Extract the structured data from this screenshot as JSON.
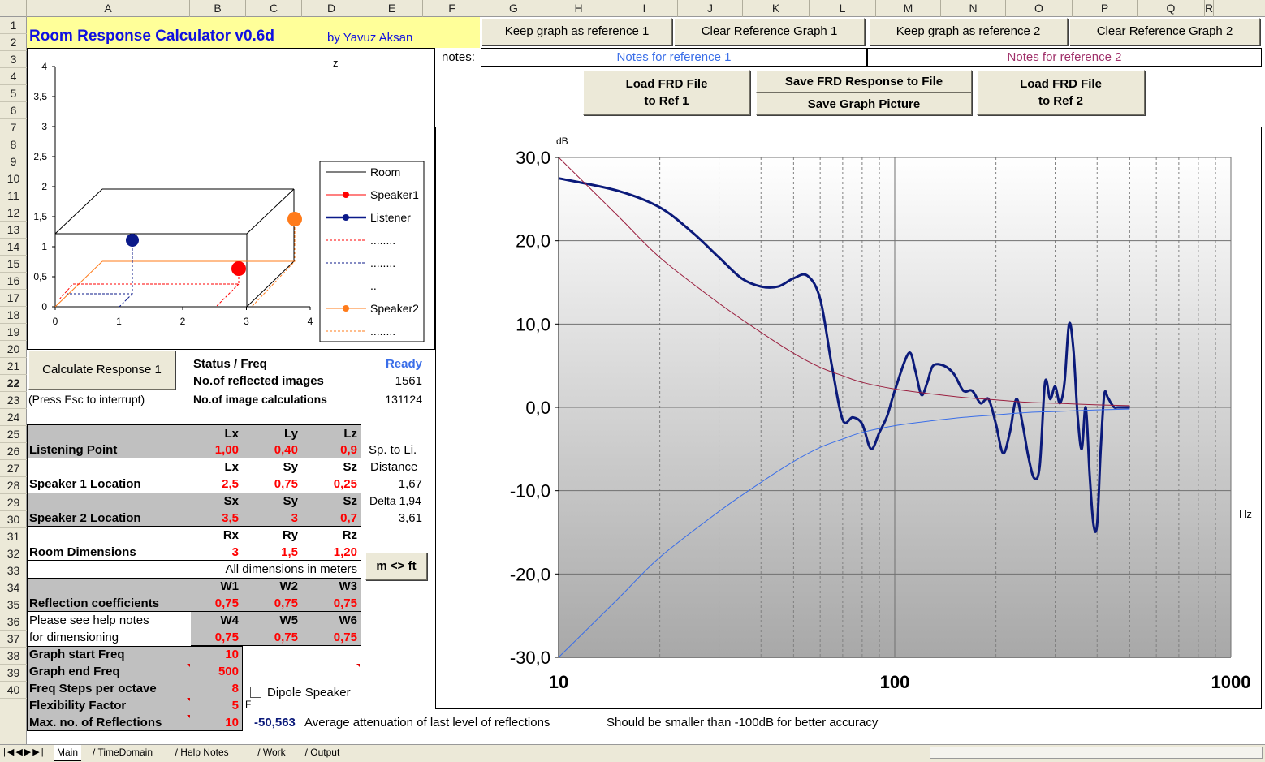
{
  "columns": [
    "A",
    "B",
    "C",
    "D",
    "E",
    "F",
    "G",
    "H",
    "I",
    "J",
    "K",
    "L",
    "M",
    "N",
    "O",
    "P",
    "Q",
    "R"
  ],
  "rows": [
    "1",
    "2",
    "3",
    "4",
    "5",
    "6",
    "7",
    "8",
    "9",
    "10",
    "11",
    "12",
    "13",
    "14",
    "15",
    "16",
    "17",
    "18",
    "19",
    "20",
    "21",
    "22",
    "23",
    "24",
    "25",
    "26",
    "27",
    "28",
    "29",
    "30",
    "31",
    "32",
    "33",
    "34",
    "35",
    "36",
    "37",
    "38",
    "39",
    "40"
  ],
  "title": "Room Response Calculator  v0.6d",
  "author": "by Yavuz Aksan",
  "buttons": {
    "keep_ref1": "Keep graph as reference 1",
    "clear_ref1": "Clear Reference Graph 1",
    "keep_ref2": "Keep graph as reference 2",
    "clear_ref2": "Clear Reference Graph 2",
    "load_frd1_a": "Load FRD File",
    "load_frd1_b": "to Ref 1",
    "save_frd": "Save FRD Response to File",
    "save_pic": "Save Graph Picture",
    "load_frd2_a": "Load FRD File",
    "load_frd2_b": "to Ref 2",
    "calc": "Calculate Response 1",
    "units": "m <> ft"
  },
  "notes_label": "notes:",
  "notes_ref1": "Notes for reference 1",
  "notes_ref2": "Notes for reference 2",
  "room_chart": {
    "z_label": "z",
    "y_ticks": [
      "4",
      "3,5",
      "3",
      "2,5",
      "2",
      "1,5",
      "1",
      "0,5",
      "0"
    ],
    "x_ticks": [
      "0",
      "1",
      "2",
      "3",
      "4"
    ],
    "legend": [
      "Room",
      "Speaker1",
      "Listener",
      "........",
      "........",
      "..",
      "Speaker2",
      "........"
    ],
    "colors": {
      "speaker1": "#ff0000",
      "listener": "#0b1a8a",
      "speaker2": "#ff7b1a"
    }
  },
  "status": {
    "status_label": "Status / Freq",
    "status_value": "Ready",
    "refl_label": "No.of reflected images",
    "refl_value": "1561",
    "calc_label": "No.of image calculations",
    "calc_value": "131124",
    "esc_note": "(Press Esc to interrupt)"
  },
  "params": {
    "lx": "Lx",
    "ly": "Ly",
    "lz": "Lz",
    "listening_label": "Listening Point",
    "listening": [
      "1,00",
      "0,40",
      "0,9"
    ],
    "sp_to_li": "Sp. to Li.",
    "lx2": "Lx",
    "sy": "Sy",
    "sz": "Sz",
    "distance": "Distance",
    "sp1_label": "Speaker 1 Location",
    "sp1": [
      "2,5",
      "0,75",
      "0,25"
    ],
    "sp1_dist": "1,67",
    "sx": "Sx",
    "sy2": "Sy",
    "sz2": "Sz",
    "delta": "Delta 1,94",
    "sp2_label": "Speaker 2 Location",
    "sp2": [
      "3,5",
      "3",
      "0,7"
    ],
    "sp2_dist": "3,61",
    "rx": "Rx",
    "ry": "Ry",
    "rz": "Rz",
    "room_label": "Room Dimensions",
    "room": [
      "3",
      "1,5",
      "1,20"
    ],
    "all_dims": "All dimensions in meters",
    "w1": "W1",
    "w2": "W2",
    "w3": "W3",
    "refl_label": "Reflection coefficients",
    "refl": [
      "0,75",
      "0,75",
      "0,75"
    ],
    "help1": "Please see help notes",
    "help2": "for dimensioning",
    "w4": "W4",
    "w5": "W5",
    "w6": "W6",
    "refl2": [
      "0,75",
      "0,75",
      "0,75"
    ],
    "start_label": "Graph start Freq",
    "start_value": "10",
    "end_label": "Graph end Freq",
    "end_value": "500",
    "steps_label": "Freq Steps per octave",
    "steps_value": "8",
    "flex_label": "Flexibility Factor",
    "flex_value": "5",
    "flex_suffix": "F",
    "maxrefl_label": "Max. no. of Reflections",
    "maxrefl_value": "10",
    "dipole": "Dipole Speaker",
    "atten_value": "-50,563",
    "atten_label": "Average attenuation of last level of reflections",
    "atten_note": "Should be smaller than -100dB for better accuracy"
  },
  "chart_data": {
    "type": "line",
    "ylabel": "dB",
    "xlabel": "Hz",
    "x_scale": "log",
    "xlim": [
      10,
      1000
    ],
    "ylim": [
      -30,
      30
    ],
    "x_ticks": [
      "10",
      "100",
      "1000"
    ],
    "y_ticks": [
      "30,0",
      "20,0",
      "10,0",
      "0,0",
      "-10,0",
      "-20,0",
      "-30,0"
    ],
    "series": [
      {
        "color": "#0b1a7a",
        "x": [
          10,
          15,
          20,
          25,
          30,
          35,
          40,
          45,
          50,
          55,
          60,
          65,
          70,
          75,
          80,
          85,
          90,
          95,
          100,
          110,
          115,
          120,
          125,
          130,
          140,
          150,
          160,
          170,
          180,
          190,
          200,
          210,
          220,
          230,
          240,
          250,
          260,
          270,
          280,
          290,
          300,
          310,
          320,
          330,
          340,
          350,
          360,
          370,
          380,
          390,
          400,
          410,
          420,
          430,
          440,
          450,
          460,
          470,
          480,
          490,
          500
        ],
        "y": [
          27.5,
          26,
          24,
          21,
          18,
          15.5,
          14.5,
          14.5,
          15.5,
          15.8,
          13,
          5,
          -1.5,
          -1.2,
          -2,
          -5,
          -3,
          -1,
          2,
          6.5,
          4.5,
          1.5,
          3,
          5,
          5,
          4,
          2,
          2,
          0.5,
          1,
          -2,
          -5.5,
          -3,
          1,
          -2,
          -6,
          -8.5,
          -7,
          3,
          1,
          2.5,
          0.5,
          3,
          10,
          7,
          -1,
          -5,
          0,
          -8,
          -14,
          -14,
          -5,
          1.5,
          1.2,
          0.5,
          0,
          0,
          0,
          0,
          0,
          0
        ]
      },
      {
        "color": "#9b2040",
        "x": [
          10,
          15,
          20,
          30,
          40,
          50,
          60,
          70,
          80,
          100,
          130,
          160,
          200,
          250,
          300,
          400,
          500
        ],
        "y": [
          30,
          23,
          18,
          12.5,
          9,
          6.5,
          4.8,
          3.8,
          3,
          2.2,
          1.6,
          1.2,
          0.9,
          0.6,
          0.5,
          0.3,
          0.2
        ]
      },
      {
        "color": "#3a6ee8",
        "x": [
          10,
          15,
          20,
          30,
          40,
          50,
          60,
          70,
          80,
          100,
          130,
          160,
          200,
          250,
          300,
          400,
          500
        ],
        "y": [
          -30,
          -23,
          -18,
          -12.5,
          -9,
          -6.5,
          -4.8,
          -3.8,
          -3,
          -2.2,
          -1.6,
          -1.2,
          -0.9,
          -0.6,
          -0.5,
          -0.3,
          -0.2
        ]
      }
    ]
  },
  "sheet_tabs": [
    "Main",
    "TimeDomain",
    "Help Notes",
    "Work",
    "Output"
  ]
}
